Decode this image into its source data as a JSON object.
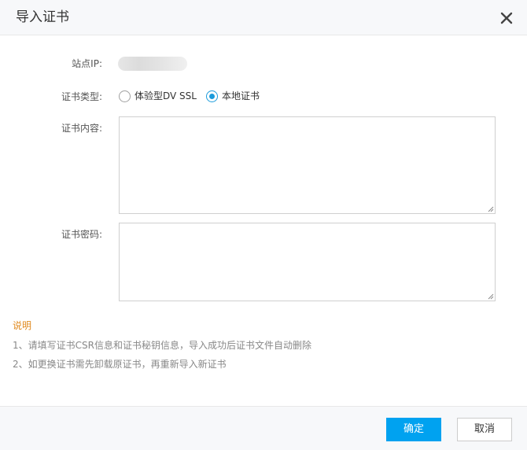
{
  "dialog": {
    "title": "导入证书",
    "close_icon": "close-icon"
  },
  "form": {
    "site_ip_label": "站点IP:",
    "cert_type_label": "证书类型:",
    "cert_type_options": [
      {
        "label": "体验型DV SSL",
        "checked": false
      },
      {
        "label": "本地证书",
        "checked": true
      }
    ],
    "cert_content_label": "证书内容:",
    "cert_content_value": "",
    "cert_key_label": "证书密码:",
    "cert_key_value": ""
  },
  "notes": {
    "title": "说明",
    "lines": [
      "1、请填写证书CSR信息和证书秘钥信息，导入成功后证书文件自动删除",
      "2、如更换证书需先卸载原证书，再重新导入新证书"
    ]
  },
  "footer": {
    "confirm_label": "确定",
    "cancel_label": "取消"
  },
  "colors": {
    "accent": "#00a2f0",
    "radio": "#1a9bdb",
    "note_title": "#e08a1e"
  }
}
